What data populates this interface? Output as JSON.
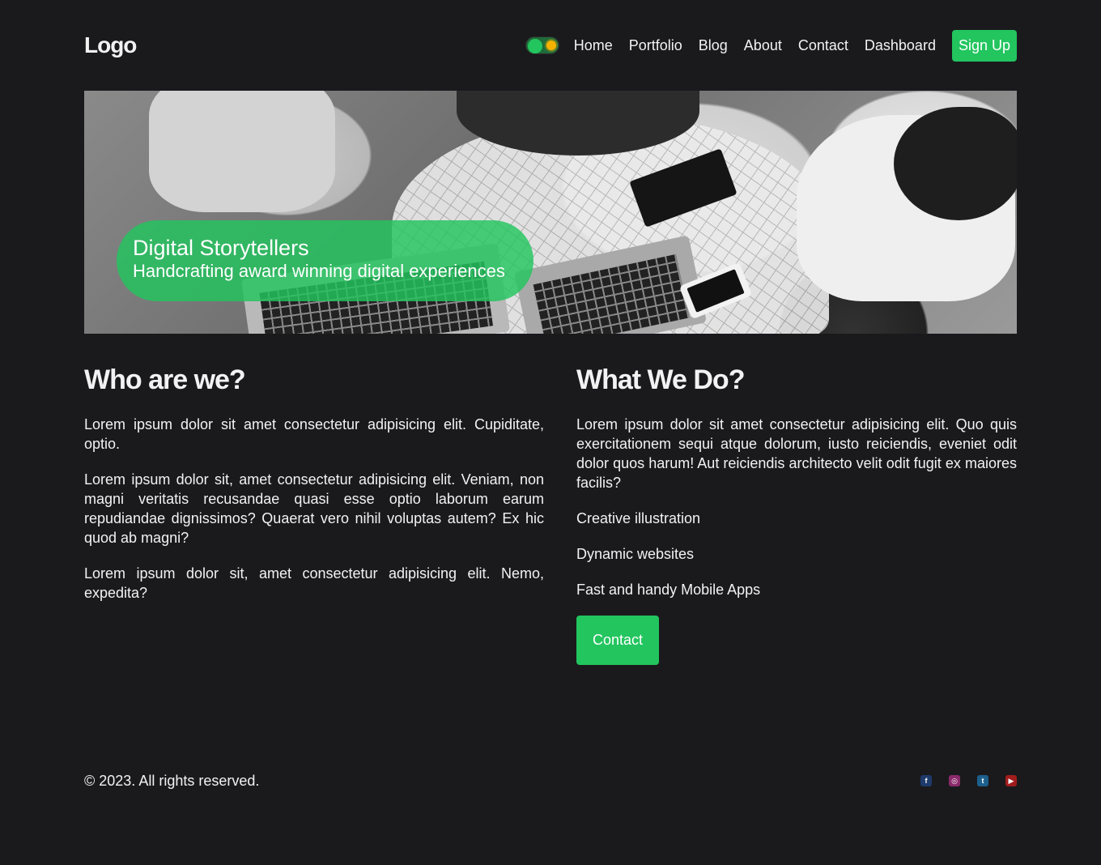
{
  "header": {
    "logo": "Logo",
    "nav": [
      "Home",
      "Portfolio",
      "Blog",
      "About",
      "Contact",
      "Dashboard"
    ],
    "signup_label": "Sign Up"
  },
  "hero": {
    "title": "Digital Storytellers",
    "subtitle": "Handcrafting award winning digital experiences"
  },
  "who": {
    "heading": "Who are we?",
    "paragraphs": [
      "Lorem ipsum dolor sit amet consectetur adipisicing elit. Cupiditate, optio.",
      "Lorem ipsum dolor sit, amet consectetur adipisicing elit. Veniam, non magni veritatis recusandae quasi esse optio laborum earum repudiandae dignissimos? Quaerat vero nihil voluptas autem? Ex hic quod ab magni?",
      "Lorem ipsum dolor sit, amet consectetur adipisicing elit. Nemo, expedita?"
    ]
  },
  "what": {
    "heading": "What We Do?",
    "intro": "Lorem ipsum dolor sit amet consectetur adipisicing elit. Quo quis exercitationem sequi atque dolorum, iusto reiciendis, eveniet odit dolor quos harum! Aut reiciendis architecto velit odit fugit ex maiores facilis?",
    "services": [
      "Creative illustration",
      "Dynamic websites",
      "Fast and handy Mobile Apps"
    ],
    "contact_label": "Contact"
  },
  "footer": {
    "copyright": "© 2023. All rights reserved.",
    "social": [
      {
        "icon": "facebook-icon",
        "glyph": "f",
        "color": "#1e3a6b"
      },
      {
        "icon": "instagram-icon",
        "glyph": "◎",
        "color": "#8b2a6a"
      },
      {
        "icon": "twitter-icon",
        "glyph": "t",
        "color": "#1d5f8c"
      },
      {
        "icon": "youtube-icon",
        "glyph": "▶",
        "color": "#a11d1d"
      }
    ]
  },
  "colors": {
    "background": "#1a1a1d",
    "accent": "#22c55e",
    "text": "#f2f2f2"
  }
}
